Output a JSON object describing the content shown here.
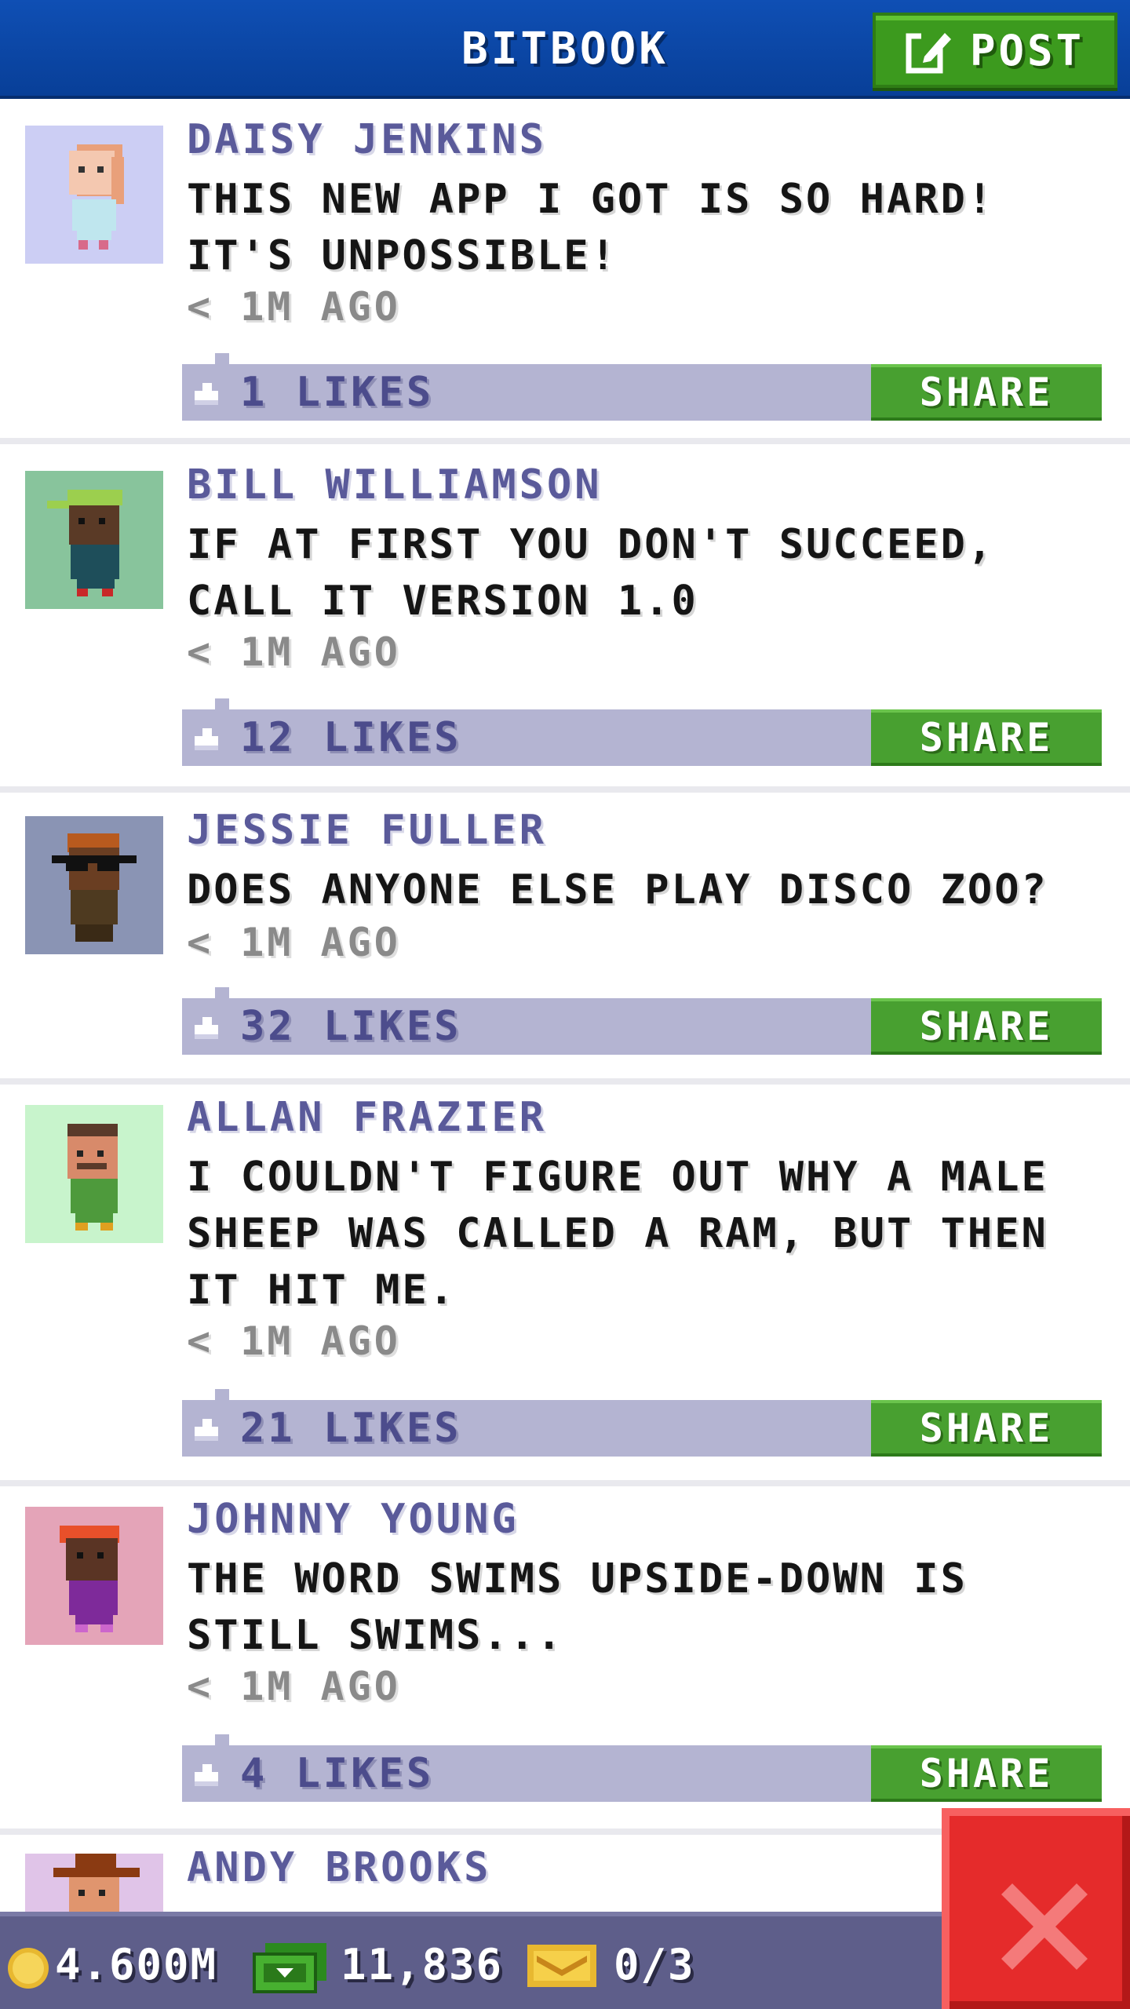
{
  "header": {
    "title": "BITBOOK",
    "post_label": "POST"
  },
  "posts": [
    {
      "author": "DAISY JENKINS",
      "text": "THIS NEW APP I GOT IS SO HARD! IT'S UNPOSSIBLE!",
      "time": "< 1M AGO",
      "likes": "1 LIKES",
      "share": "SHARE",
      "avatar_bg": "#cccef4"
    },
    {
      "author": "BILL WILLIAMSON",
      "text": "IF AT FIRST YOU DON'T SUCCEED, CALL IT VERSION 1.0",
      "time": "< 1M AGO",
      "likes": "12 LIKES",
      "share": "SHARE",
      "avatar_bg": "#88c49c"
    },
    {
      "author": "JESSIE FULLER",
      "text": "DOES ANYONE ELSE PLAY DISCO ZOO?",
      "time": "< 1M AGO",
      "likes": "32 LIKES",
      "share": "SHARE",
      "avatar_bg": "#8a94b4"
    },
    {
      "author": "ALLAN FRAZIER",
      "text": "I COULDN'T FIGURE OUT WHY A MALE SHEEP WAS CALLED A RAM, BUT THEN IT HIT ME.",
      "time": "< 1M AGO",
      "likes": "21 LIKES",
      "share": "SHARE",
      "avatar_bg": "#c8f4cc"
    },
    {
      "author": "JOHNNY YOUNG",
      "text": "THE WORD SWIMS UPSIDE-DOWN IS STILL SWIMS...",
      "time": "< 1M AGO",
      "likes": "4 LIKES",
      "share": "SHARE",
      "avatar_bg": "#e4a4b8"
    },
    {
      "author": "ANDY BROOKS",
      "avatar_bg": "#e0c4e8"
    }
  ],
  "status": {
    "coins": "4.600M",
    "bux": "11,836",
    "tickets": "0/3"
  },
  "colors": {
    "header": "#0f4fb4",
    "accent_green": "#48a030",
    "like_bar": "#b4b4d2",
    "close_red": "#e52b2b"
  }
}
